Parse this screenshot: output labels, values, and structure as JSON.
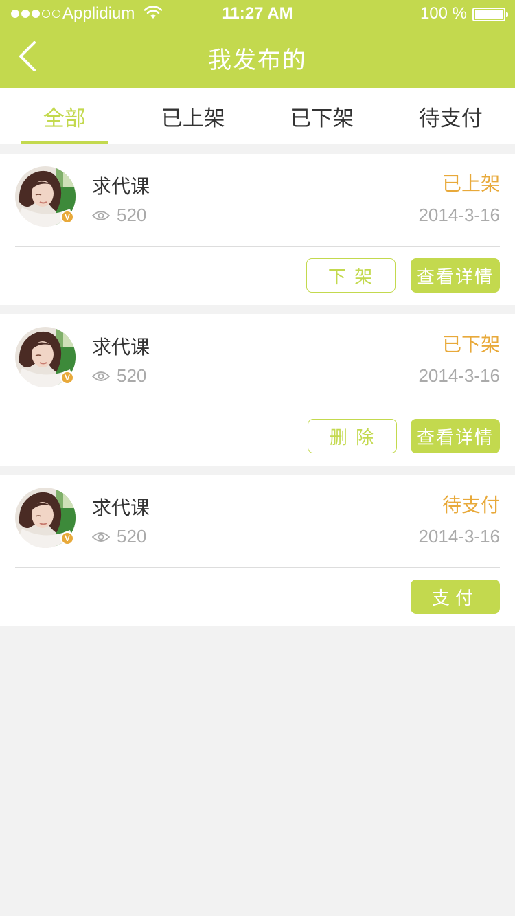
{
  "status_bar": {
    "carrier": "Applidium",
    "time": "11:27 AM",
    "battery": "100 %",
    "signal_bars_filled": 3,
    "signal_bars_total": 5
  },
  "nav": {
    "title": "我发布的",
    "back_icon": "chevron-left-icon"
  },
  "tabs": [
    {
      "label": "全部",
      "active": true
    },
    {
      "label": "已上架",
      "active": false
    },
    {
      "label": "已下架",
      "active": false
    },
    {
      "label": "待支付",
      "active": false
    }
  ],
  "cards": [
    {
      "title": "求代课",
      "views": "520",
      "status": "已上架",
      "date": "2014-3-16",
      "secondary_button": "下 架",
      "detail_button": "查看详情"
    },
    {
      "title": "求代课",
      "views": "520",
      "status": "已下架",
      "date": "2014-3-16",
      "secondary_button": "删 除",
      "detail_button": "查看详情"
    },
    {
      "title": "求代课",
      "views": "520",
      "status": "待支付",
      "date": "2014-3-16",
      "pay_button": "支付"
    }
  ],
  "badge_letter": "V",
  "colors": {
    "brand": "#c3d94e",
    "status": "#e8a93a",
    "background": "#f2f2f2"
  }
}
